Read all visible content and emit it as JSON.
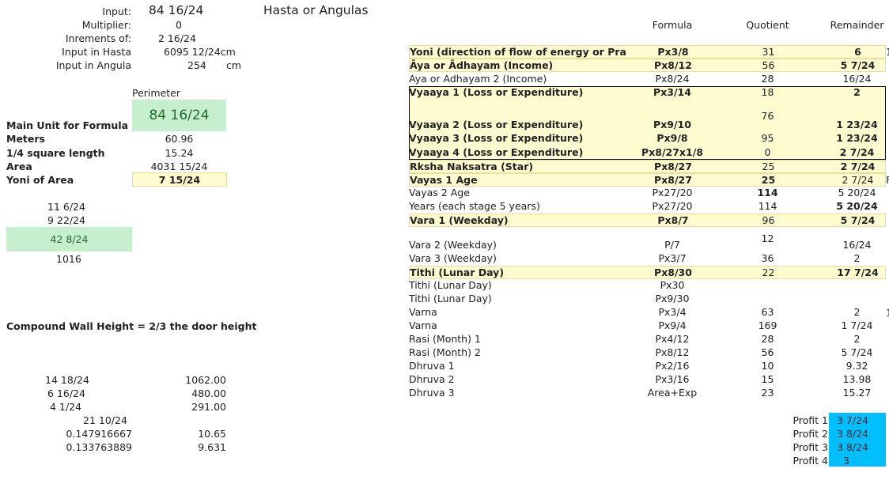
{
  "top": {
    "input_label": "Input:",
    "input_value": "84 16/24",
    "heading": "Hasta or Angulas",
    "multiplier_label": "Multiplier:",
    "multiplier_value": "0",
    "increments_label": "Inrements of:",
    "increments_value": "2 16/24",
    "hasta_label": "Input in Hasta",
    "hasta_value": "6095 12/24cm",
    "angula_label": "Input in Angula",
    "angula_value": "254",
    "angula_unit": "cm"
  },
  "left": {
    "perimeter_label": "Perimeter",
    "perimeter_value": "84 16/24",
    "main_unit_label": "Main Unit for Formula",
    "meters_label": "Meters",
    "meters_value": "60.96",
    "quarter_label": "1/4 square length",
    "quarter_value": "15.24",
    "area_label": "Area",
    "area_value": "4031 15/24",
    "yoni_area_label": "Yoni of Area",
    "yoni_area_value": "7 15/24",
    "v1": "11 6/24",
    "v2": "9 22/24",
    "v3": "42 8/24",
    "v4": "1016",
    "wall_label": "Compound Wall Height = 2/3 the door height",
    "w1a": "14 18/24",
    "w1b": "1062.00",
    "w2a": "6 16/24",
    "w2b": "480.00",
    "w3a": "4 1/24",
    "w3b": "291.00",
    "w4a": "21 10/24",
    "w5a": "0.147916667",
    "w5b": "10.65",
    "w6a": "0.133763889",
    "w6b": "9.631"
  },
  "table": {
    "h_formula": "Formula",
    "h_quotient": "Quotient",
    "h_remainder": "Remainder",
    "rows": [
      {
        "label": "Yoni (direction of flow of energy or Pra",
        "formula": "Px3/8",
        "quotient": "31",
        "remainder": "6"
      },
      {
        "label": "Āya or Ādhayam (Income)",
        "formula": "Px8/12",
        "quotient": "56",
        "remainder": "5 7/24"
      },
      {
        "label": "Aya or Adhayam 2 (Income)",
        "formula": "Px8/24",
        "quotient": "28",
        "remainder": "16/24"
      },
      {
        "label": "Vyaaya 1 (Loss or Expenditure)",
        "formula": "Px3/14",
        "quotient": "18",
        "remainder": "2"
      },
      {
        "label": "Vyaaya 2 (Loss or Expenditure)",
        "formula": "Px9/10",
        "quotient": "76",
        "remainder": "1 23/24"
      },
      {
        "label": "Vyaaya 3 (Loss or Expenditure)",
        "formula": "Px9/8",
        "quotient": "95",
        "remainder": "1 23/24"
      },
      {
        "label": "Vyaaya 4 (Loss or Expenditure)",
        "formula": "Px8/27x1/8",
        "quotient": "0",
        "remainder": "2 7/24"
      },
      {
        "label": "Rksha Naksatra (Star)",
        "formula": "Px8/27",
        "quotient": "25",
        "remainder": "2 7/24"
      },
      {
        "label": "Vayas 1 Age",
        "formula": "Px8/27",
        "quotient": "25",
        "remainder": "2 7/24"
      },
      {
        "label": "Vayas 2 Age",
        "formula": "Px27/20",
        "quotient": "114",
        "remainder": "5 20/24"
      },
      {
        "label": "Years (each stage 5 years)",
        "formula": "Px27/20",
        "quotient": "114",
        "remainder": "5 20/24"
      },
      {
        "label": "Vara 1 (Weekday)",
        "formula": "Px8/7",
        "quotient": "96",
        "remainder": "5 7/24"
      },
      {
        "label": "Vara 2 (Weekday)",
        "formula": "P/7",
        "quotient": "12",
        "remainder": "16/24"
      },
      {
        "label": "Vara 3 (Weekday)",
        "formula": "Px3/7",
        "quotient": "36",
        "remainder": "2"
      },
      {
        "label": "Tithi (Lunar Day)",
        "formula": "Px8/30",
        "quotient": "22",
        "remainder": "17 7/24"
      },
      {
        "label": "Tithi (Lunar Day)",
        "formula": "Px30",
        "quotient": "",
        "remainder": ""
      },
      {
        "label": "Tithi (Lunar Day)",
        "formula": "Px9/30",
        "quotient": "",
        "remainder": ""
      },
      {
        "label": "Varna",
        "formula": "Px3/4",
        "quotient": "63",
        "remainder": "2"
      },
      {
        "label": "Varna",
        "formula": "Px9/4",
        "quotient": "169",
        "remainder": "1 7/24"
      },
      {
        "label": "Rasi (Month) 1",
        "formula": "Px4/12",
        "quotient": "28",
        "remainder": "2"
      },
      {
        "label": "Rasi (Month) 2",
        "formula": "Px8/12",
        "quotient": "56",
        "remainder": "5 7/24"
      },
      {
        "label": "Dhruva 1",
        "formula": "Px2/16",
        "quotient": "10",
        "remainder": "9.32"
      },
      {
        "label": "Dhruva 2",
        "formula": "Px3/16",
        "quotient": "15",
        "remainder": "13.98"
      },
      {
        "label": "Dhruva 3",
        "formula": "Area+Exp",
        "quotient": "23",
        "remainder": "15.27"
      }
    ],
    "edge_1": "1",
    "edge_8": "F",
    "edge_17": "1"
  },
  "profit": [
    {
      "label": "Profit 1",
      "value": "3 7/24"
    },
    {
      "label": "Profit 2",
      "value": "3 8/24"
    },
    {
      "label": "Profit 3",
      "value": "3 8/24"
    },
    {
      "label": "Profit 4",
      "value": "3"
    }
  ],
  "colors": {
    "yellow_fill": "#fffbd0",
    "green_fill": "#c6efce",
    "cyan_fill": "#00bfff"
  }
}
